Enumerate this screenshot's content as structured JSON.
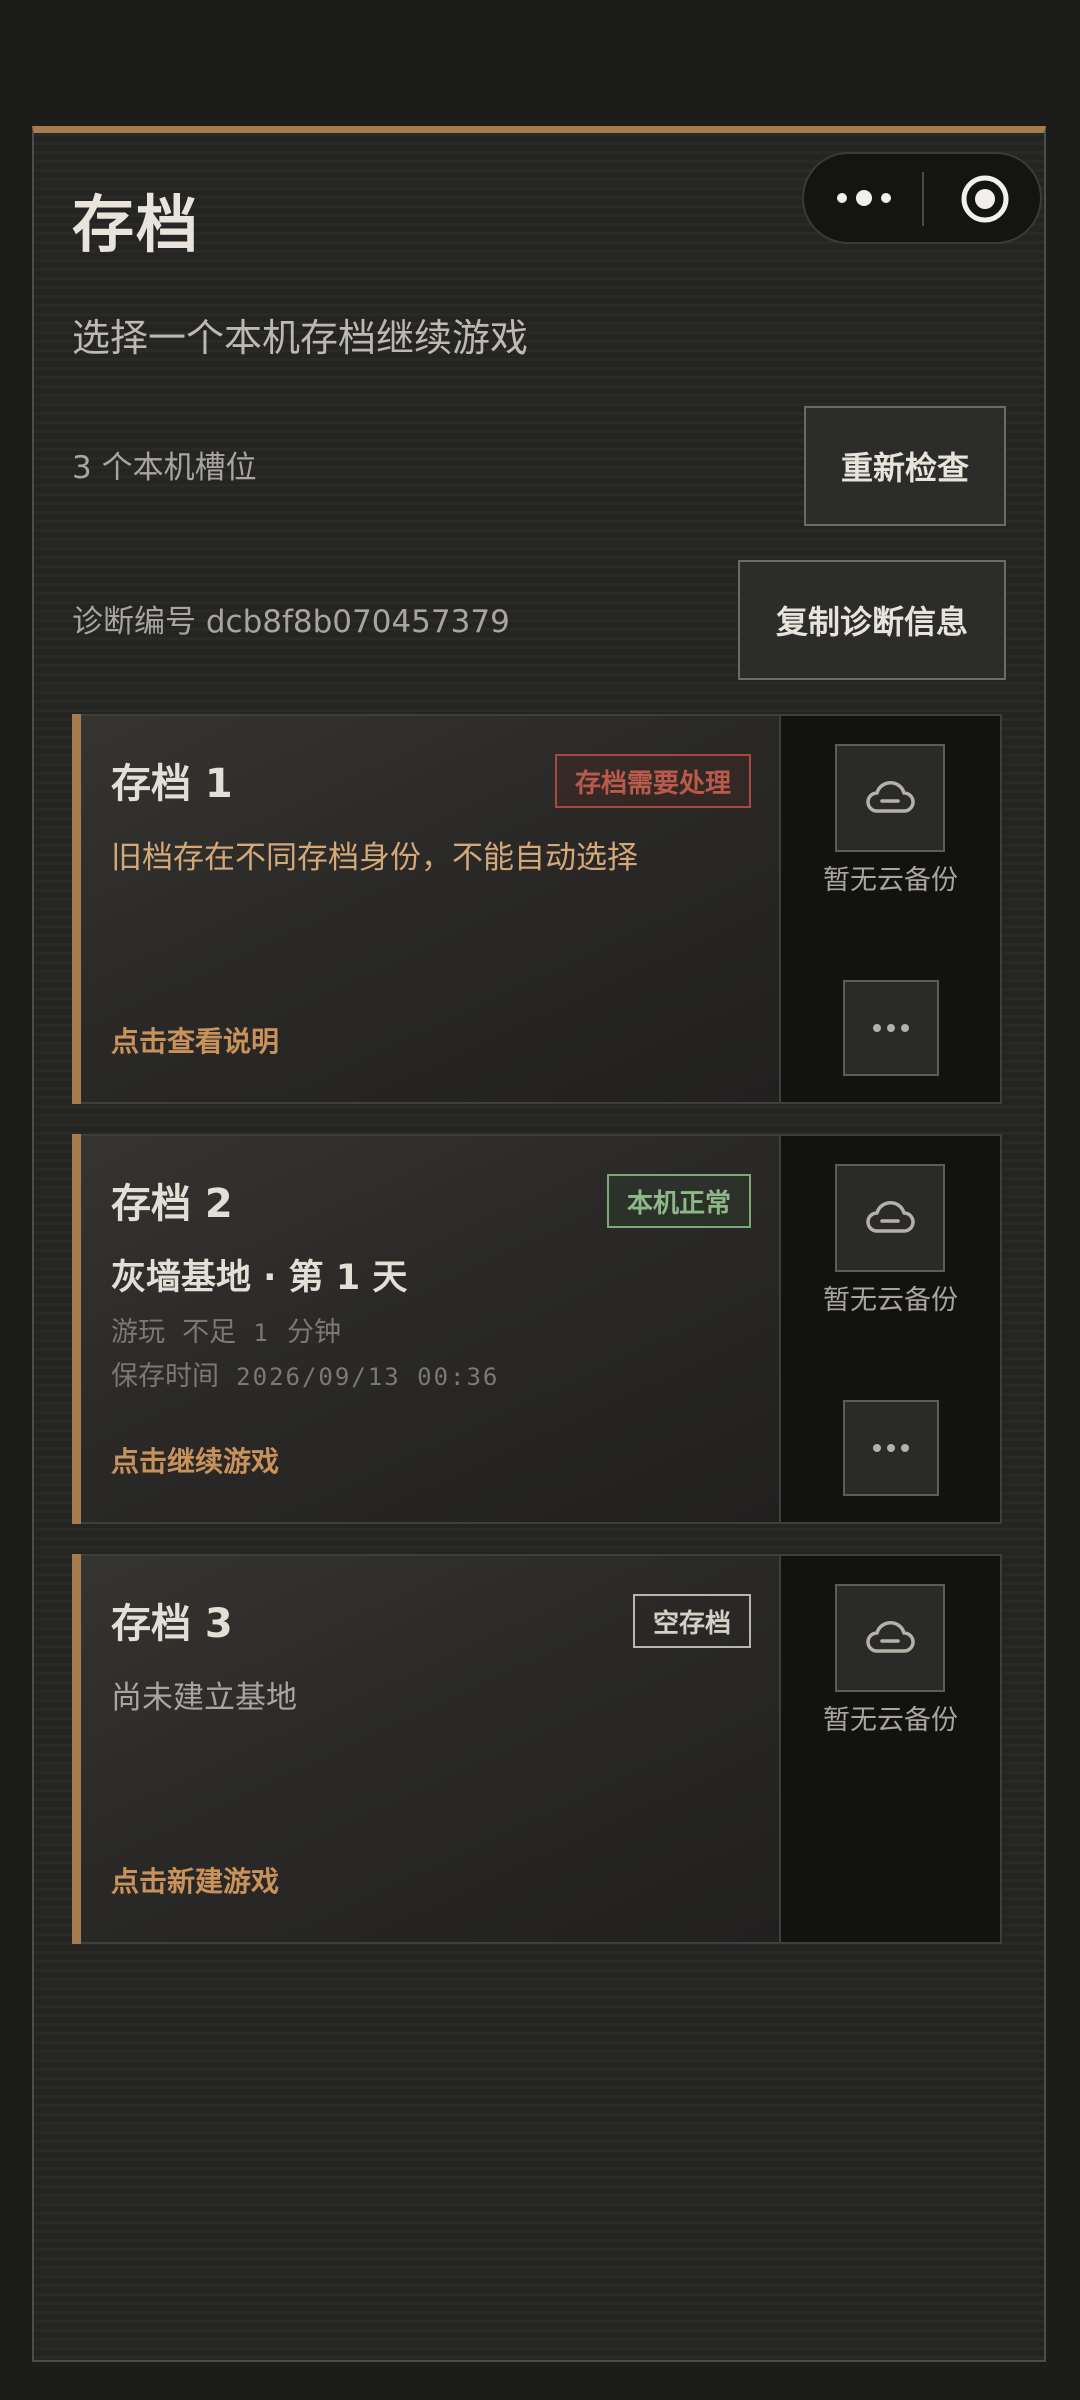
{
  "page": {
    "title": "存档",
    "subtitle": "选择一个本机存档继续游戏",
    "slot_count": "3 个本机槽位",
    "diagnostic": "诊断编号 dcb8f8b070457379",
    "recheck_label": "重新检查",
    "copy_diag_label": "复制诊断信息"
  },
  "capsule": {
    "menu_icon": "more-dots-icon",
    "close_icon": "target-circle-icon"
  },
  "slots": [
    {
      "title": "存档 1",
      "badge": "存档需要处理",
      "status": "warning",
      "desc": "旧档存在不同存档身份，不能自动选择",
      "action": "点击查看说明",
      "cloud_label": "暂无云备份"
    },
    {
      "title": "存档 2",
      "badge": "本机正常",
      "status": "ok",
      "base_line": "灰墙基地 · 第 1 天",
      "play_label": "游玩",
      "play_value_prefix": "不足",
      "play_value_num": "1",
      "play_value_unit": "分钟",
      "saved_label": "保存时间",
      "saved_time": "2026/09/13 00:36",
      "action": "点击继续游戏",
      "cloud_label": "暂无云备份"
    },
    {
      "title": "存档 3",
      "badge": "空存档",
      "status": "empty",
      "desc": "尚未建立基地",
      "action": "点击新建游戏",
      "cloud_label": "暂无云备份"
    }
  ],
  "colors": {
    "accent": "#a67b4f",
    "warning": "#b85a4c",
    "ok": "#8fb88a",
    "action": "#c9925a"
  }
}
